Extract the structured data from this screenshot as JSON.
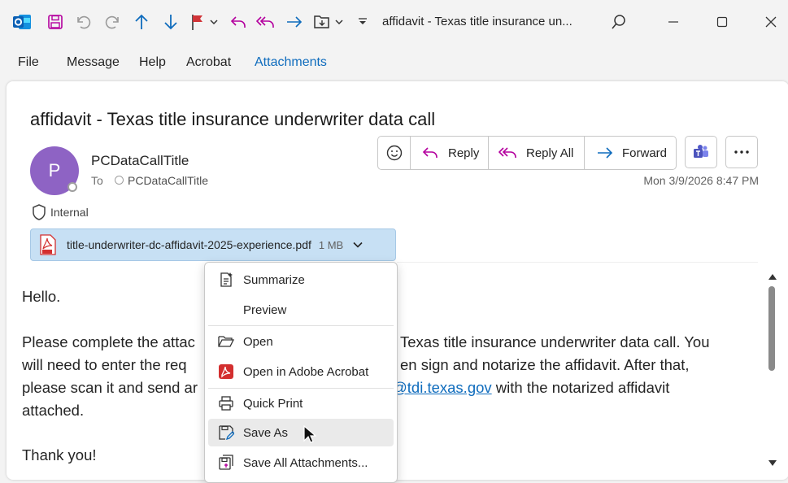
{
  "window": {
    "title": "affidavit - Texas title insurance un..."
  },
  "ribbon_tabs": [
    "File",
    "Message",
    "Help",
    "Acrobat",
    "Attachments"
  ],
  "active_tab": "Attachments",
  "message": {
    "subject": "affidavit - Texas title insurance underwriter data call",
    "sender_initial": "P",
    "sender_name": "PCDataCallTitle",
    "to_label": "To",
    "recipient": "PCDataCallTitle",
    "date": "Mon 3/9/2026 8:47 PM",
    "sensitivity": "Internal",
    "actions": {
      "reply": "Reply",
      "reply_all": "Reply All",
      "forward": "Forward"
    },
    "attachment": {
      "name": "title-underwriter-dc-affidavit-2025-experience.pdf",
      "size": "1 MB"
    },
    "body": {
      "greeting": "Hello.",
      "line1_left": "Please complete the attac",
      "line1_right": "Texas title insurance underwriter data call.  You",
      "line2_left": "will need to enter the req",
      "line2_right": "en sign and notarize the affidavit.  After that,",
      "line3_left": "please scan it and send ar",
      "line3_link": "@tdi.texas.gov",
      "line3_right": " with the notarized affidavit",
      "line4": "attached.",
      "closing": "Thank you!"
    }
  },
  "context_menu": {
    "items": [
      "Summarize",
      "Preview",
      "Open",
      "Open in Adobe Acrobat",
      "Quick Print",
      "Save As",
      "Save All Attachments..."
    ],
    "hovered": "Save As"
  },
  "colors": {
    "accent": "#0f6cbd",
    "avatar": "#8e63c4",
    "attachment_bg": "#c7e0f4",
    "pdf_red": "#d32f2f"
  }
}
